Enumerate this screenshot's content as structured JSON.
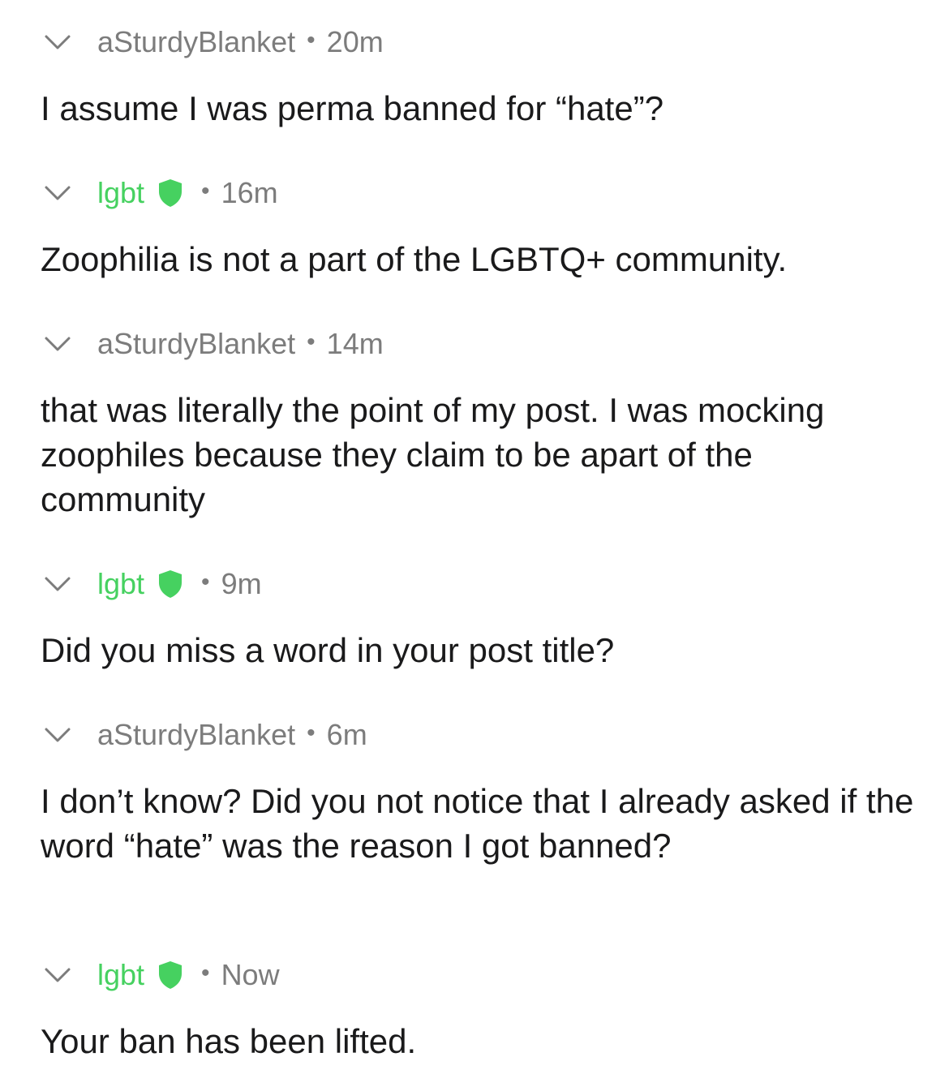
{
  "comments": [
    {
      "author": "aSturdyBlanket",
      "time": "20m",
      "body": "I assume I was perma banned for “hate”?"
    },
    {
      "author": "lgbt",
      "time": "16m",
      "body": "Zoophilia is not a part of the LGBTQ+ community."
    },
    {
      "author": "aSturdyBlanket",
      "time": "14m",
      "body": "that was literally the point of my post. I was mocking zoophiles because they claim to be apart of the community"
    },
    {
      "author": "lgbt",
      "time": "9m",
      "body": "Did you miss a word in your post title?"
    },
    {
      "author": "aSturdyBlanket",
      "time": "6m",
      "body": "I don’t know? Did you not notice that I already asked if the word “hate” was the reason I got banned?"
    },
    {
      "author": "lgbt",
      "time": "Now",
      "body": "Your ban has been lifted."
    }
  ],
  "separator": "•",
  "icons": {
    "collapse": "chevron-down-icon",
    "moderator": "shield-icon"
  },
  "colors": {
    "text": "#1a1a1b",
    "meta": "#7c7c7c",
    "moderator": "#46d160",
    "background": "#ffffff"
  }
}
